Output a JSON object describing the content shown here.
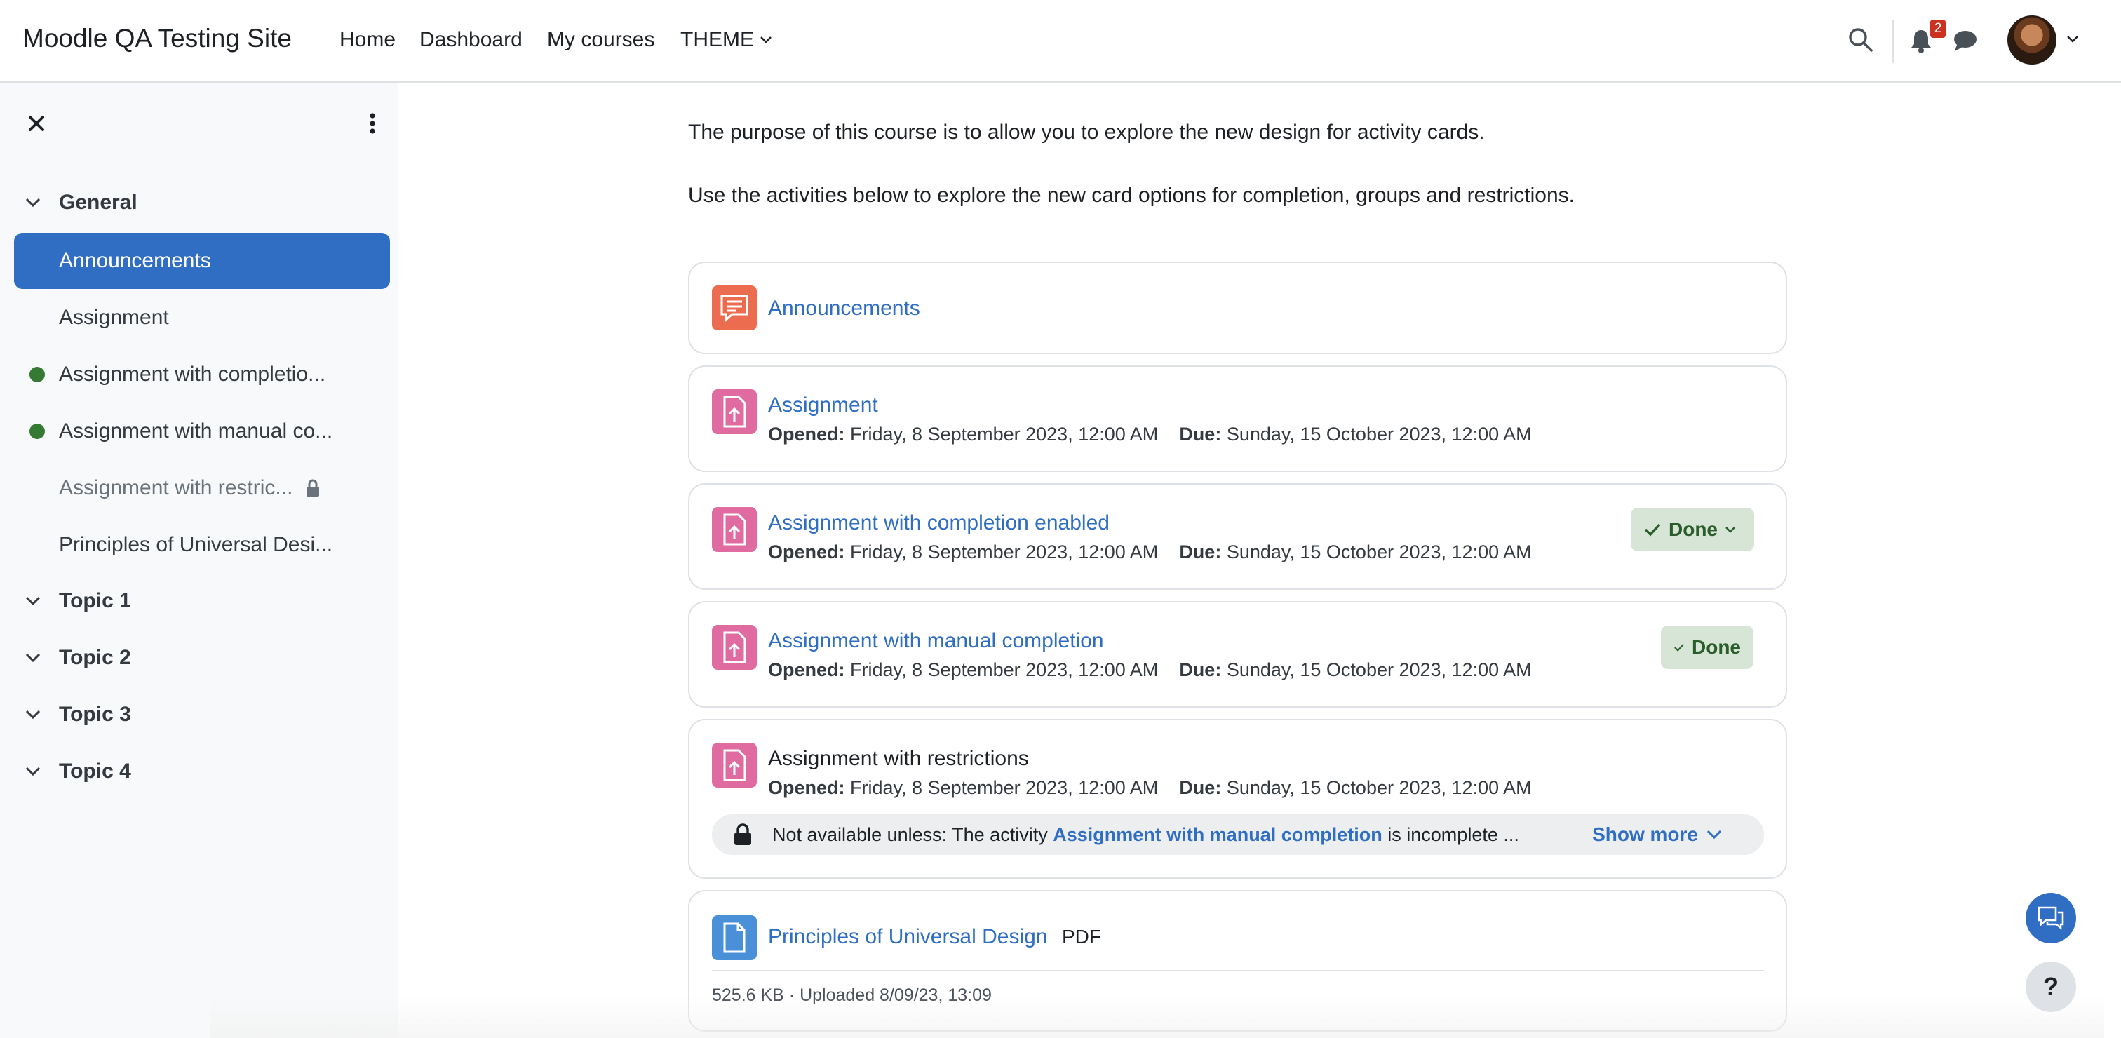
{
  "navbar": {
    "brand": "Moodle QA Testing Site",
    "links": [
      "Home",
      "Dashboard",
      "My courses"
    ],
    "theme_label": "THEME",
    "notification_count": "2",
    "icons": [
      "search-icon",
      "bell-icon",
      "chat-bubble-icon",
      "avatar",
      "chevron-down-icon"
    ]
  },
  "drawer": {
    "sections": [
      {
        "label": "General"
      },
      {
        "label": "Topic 1"
      },
      {
        "label": "Topic 2"
      },
      {
        "label": "Topic 3"
      },
      {
        "label": "Topic 4"
      }
    ],
    "items": [
      {
        "label": "Announcements",
        "active": true
      },
      {
        "label": "Assignment"
      },
      {
        "label": "Assignment with completio...",
        "completed": true
      },
      {
        "label": "Assignment with manual co...",
        "completed": true
      },
      {
        "label": "Assignment with restric...",
        "locked": true
      },
      {
        "label": "Principles of Universal Desi..."
      }
    ]
  },
  "main": {
    "intro1": "The purpose of this course is to allow you to explore the new design for activity cards.",
    "intro2": "Use the activities below to explore the new card options for completion, groups and restrictions.",
    "opened_label": "Opened:",
    "due_label": "Due:",
    "opened_value": "Friday, 8 September 2023, 12:00 AM",
    "due_value": "Sunday, 15 October 2023, 12:00 AM",
    "done_label": "Done",
    "activities": [
      {
        "title": "Announcements",
        "icon": "forum-icon"
      },
      {
        "title": "Assignment",
        "icon": "assignment-icon"
      },
      {
        "title": "Assignment with completion enabled",
        "icon": "assignment-icon"
      },
      {
        "title": "Assignment with manual completion",
        "icon": "assignment-icon"
      },
      {
        "title": "Assignment with restrictions",
        "icon": "assignment-icon"
      },
      {
        "title": "Principles of Universal Design",
        "icon": "file-icon"
      }
    ],
    "restriction": {
      "prefix": "Not available unless: The activity",
      "link": "Assignment with manual completion",
      "suffix": "is incomplete ...",
      "show_more": "Show more"
    },
    "file": {
      "type": "PDF",
      "meta": "525.6 KB · Uploaded 8/09/23, 13:09"
    }
  },
  "floating": {
    "help_label": "?"
  },
  "colors": {
    "primary": "#2f6ec2",
    "forum_icon_bg": "#eb6c4f",
    "assign_icon_bg": "#e06ba1",
    "file_icon_bg": "#4a90d9",
    "done_bg": "#d7e5d6",
    "completion_dot": "#357a32"
  }
}
